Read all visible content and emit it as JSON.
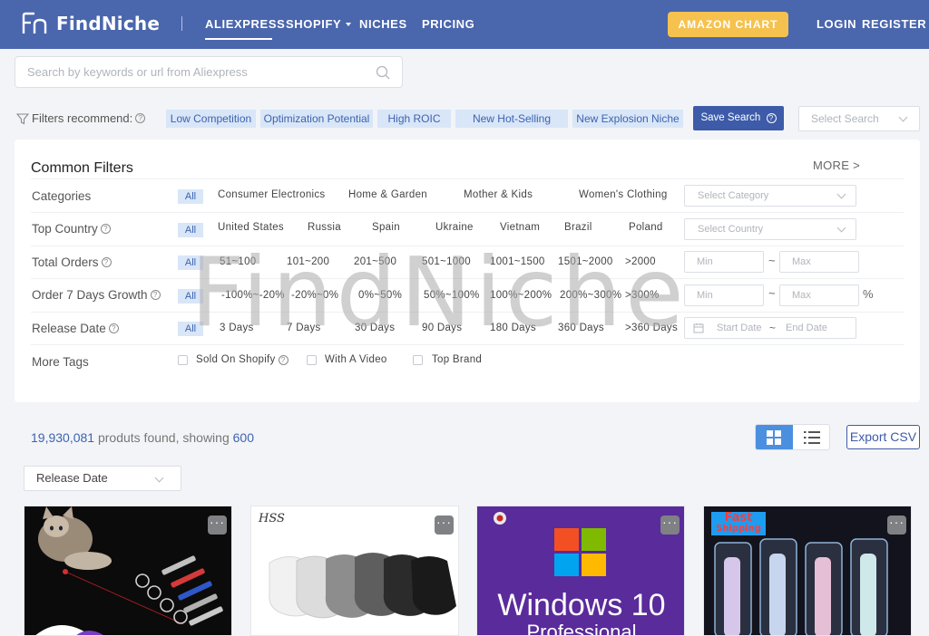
{
  "header": {
    "logo_text": "FindNiche",
    "nav": [
      "ALIEXPRESS",
      "SHOPIFY",
      "NICHES",
      "PRICING"
    ],
    "amazon_chart": "AMAZON CHART",
    "login": "LOGIN",
    "register": "REGISTER"
  },
  "search": {
    "placeholder": "Search by keywords or url from Aliexpress"
  },
  "recommend": {
    "label": "Filters recommend:",
    "chips": [
      "Low Competition",
      "Optimization Potential",
      "High ROIC",
      "New Hot-Selling",
      "New Explosion Niche"
    ],
    "save_search": "Save Search",
    "select_search_placeholder": "Select Search"
  },
  "filters": {
    "title": "Common Filters",
    "more": "MORE >",
    "all": "All",
    "categories": {
      "label": "Categories",
      "options": [
        "Consumer Electronics",
        "Home & Garden",
        "Mother & Kids",
        "Women's Clothing"
      ],
      "select_placeholder": "Select Category"
    },
    "top_country": {
      "label": "Top Country",
      "options": [
        "United States",
        "Russia",
        "Spain",
        "Ukraine",
        "Vietnam",
        "Brazil",
        "Poland"
      ],
      "select_placeholder": "Select Country"
    },
    "total_orders": {
      "label": "Total Orders",
      "options": [
        "51~100",
        "101~200",
        "201~500",
        "501~1000",
        "1001~1500",
        "1501~2000",
        ">2000"
      ],
      "min": "Min",
      "max": "Max"
    },
    "order_growth": {
      "label": "Order 7 Days Growth",
      "options": [
        "-100%~-20%",
        "-20%~0%",
        "0%~50%",
        "50%~100%",
        "100%~200%",
        "200%~300%",
        ">300%"
      ],
      "min": "Min",
      "max": "Max",
      "unit": "%"
    },
    "release_date": {
      "label": "Release Date",
      "options": [
        "3 Days",
        "7 Days",
        "30 Days",
        "90 Days",
        "180 Days",
        "360 Days",
        ">360 Days"
      ],
      "start": "Start Date",
      "end": "End Date"
    },
    "more_tags": {
      "label": "More Tags",
      "options": [
        "Sold On Shopify",
        "With A Video",
        "Top Brand"
      ]
    }
  },
  "results": {
    "count": "19,930,081",
    "text": "produts found, showing",
    "showing": "600",
    "export": "Export CSV",
    "sort_value": "Release Date"
  },
  "cards": [
    {
      "image": "cat-laser-pointer"
    },
    {
      "image": "socks",
      "brand_mark": "HSS"
    },
    {
      "image": "windows-10",
      "line1": "Windows 10",
      "line2": "Professional"
    },
    {
      "image": "fast-shipping-pens",
      "badge_line1": "Fast",
      "badge_line2": "Shipping"
    }
  ],
  "watermark": "FindNiche",
  "colors": {
    "header": "#4a66ad",
    "accent": "#3d5ba8",
    "chip_bg": "#d9e6f8",
    "amazon": "#f6c24f",
    "grid_active": "#4b8fe0"
  }
}
